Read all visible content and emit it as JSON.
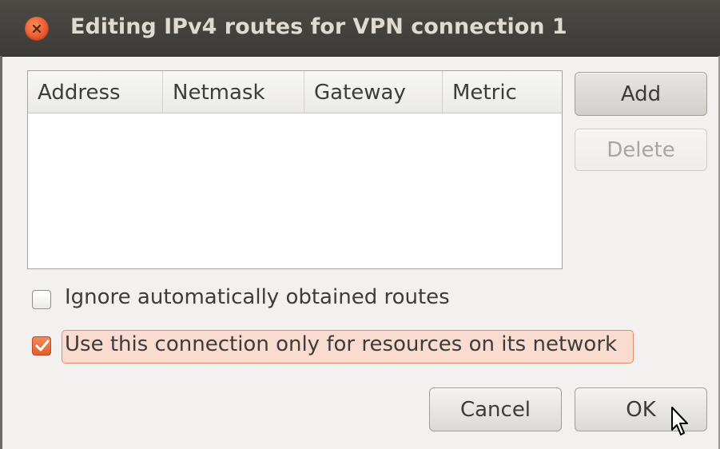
{
  "window": {
    "title": "Editing IPv4 routes for VPN connection 1"
  },
  "table": {
    "columns": [
      "Address",
      "Netmask",
      "Gateway",
      "Metric"
    ],
    "rows": []
  },
  "buttons": {
    "add": "Add",
    "delete": "Delete",
    "cancel": "Cancel",
    "ok": "OK"
  },
  "options": {
    "ignore_auto_routes": {
      "label": "Ignore automatically obtained routes",
      "checked": false
    },
    "use_only_for_network": {
      "label": "Use this connection only for resources on its network",
      "checked": true
    }
  },
  "colors": {
    "accent": "#e9572d",
    "focus": "#fadbcf",
    "titlebar": "#3c3b37"
  },
  "icons": {
    "close": "close-icon",
    "check": "checkmark-icon",
    "cursor": "mouse-pointer-icon"
  }
}
